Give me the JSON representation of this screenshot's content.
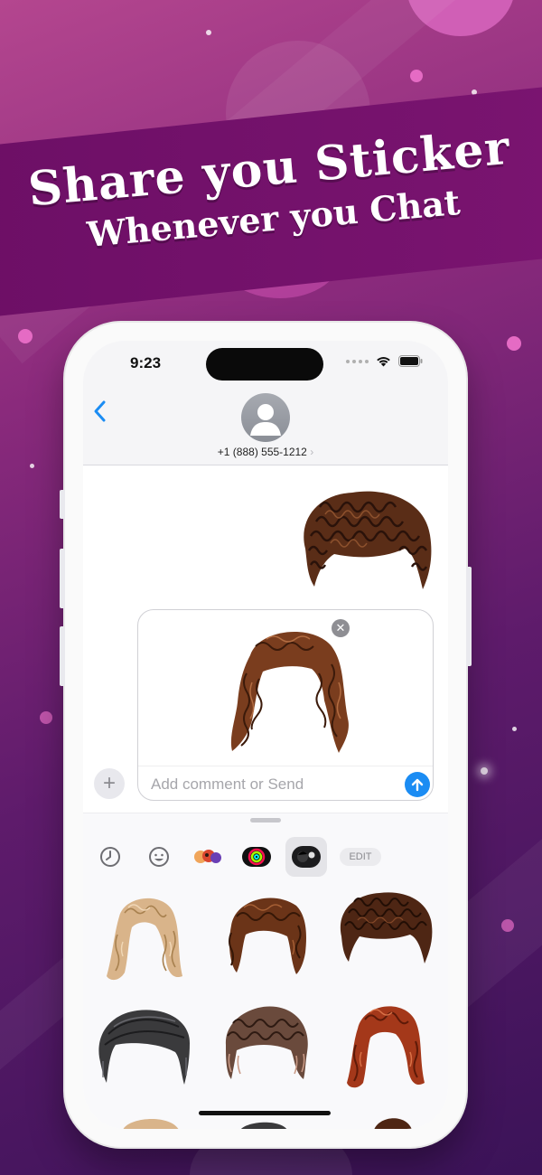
{
  "headline": {
    "line1": "Share you Sticker",
    "line2": "Whenever you Chat"
  },
  "status_bar": {
    "time": "9:23"
  },
  "conversation": {
    "contact_number": "+1 (888) 555-1212",
    "contact_chevron": "›"
  },
  "compose": {
    "placeholder": "Add comment or Send",
    "close_glyph": "✕",
    "plus_glyph": "+"
  },
  "drawer": {
    "edit_label": "EDIT",
    "app_icons": [
      "recents-clock-icon",
      "emoji-icon",
      "memoji-stickers-icon",
      "activity-rings-icon",
      "hair-sticker-app-icon"
    ]
  },
  "colors": {
    "accent": "#1b8cf3",
    "banner": "#6d0f66",
    "background_top": "#b4468f",
    "background_bottom": "#3b1358"
  }
}
